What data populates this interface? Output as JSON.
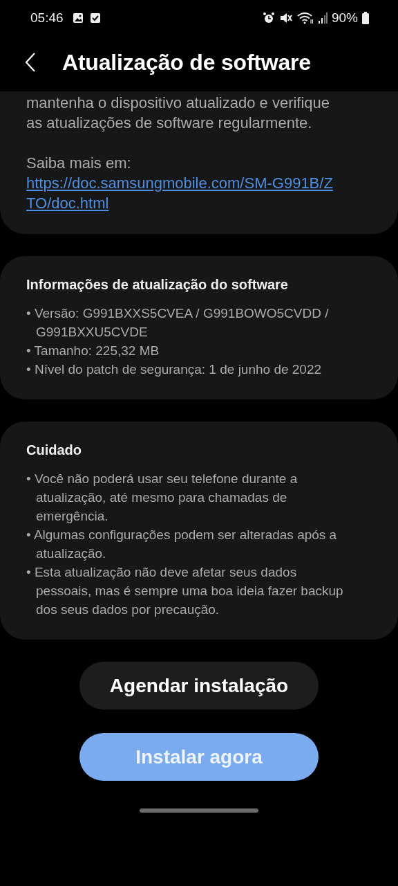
{
  "status_bar": {
    "time": "05:46",
    "battery": "90%"
  },
  "header": {
    "title": "Atualização de software"
  },
  "intro_card": {
    "paragraphs": [
      "mantenha o dispositivo atualizado e verifique as atualizações de software regularmente.",
      "Saiba mais em:"
    ],
    "link": "https://doc.samsungmobile.com/SM-G991B/ZTO/doc.html"
  },
  "sections": [
    {
      "title": "Informações de atualização do software",
      "items": [
        "• Versão: G991BXXS5CVEA / G991BOWO5CVDD / G991BXXU5CVDE",
        "• Tamanho: 225,32 MB",
        "• Nível do patch de segurança: 1 de junho de 2022"
      ]
    },
    {
      "title": "Cuidado",
      "items": [
        "• Você não poderá usar seu telefone durante a atualização, até mesmo para chamadas de emergência.",
        "• Algumas configurações podem ser alteradas após a atualização.",
        "• Esta atualização não deve afetar seus dados pessoais, mas é sempre uma boa ideia fazer backup dos seus dados por precaução."
      ]
    }
  ],
  "buttons": [
    {
      "label": "Agendar instalação",
      "kind": "secondary"
    },
    {
      "label": "Instalar agora",
      "kind": "primary"
    }
  ]
}
